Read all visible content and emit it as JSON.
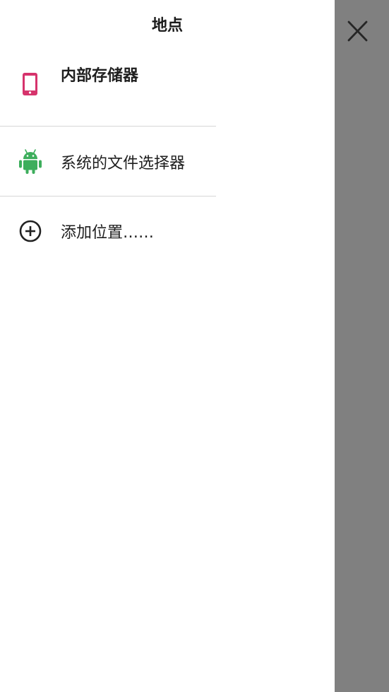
{
  "header": {
    "title": "地点"
  },
  "locations": [
    {
      "label": "内部存储器",
      "icon": "phone-icon",
      "color": "#d6336c"
    },
    {
      "label": "系统的文件选择器",
      "icon": "android-icon",
      "color": "#3dae5c"
    },
    {
      "label": "添加位置……",
      "icon": "add-circle-icon",
      "color": "#222222"
    }
  ],
  "close": {
    "icon": "close-icon"
  },
  "colors": {
    "scrim": "#808080",
    "drawer_background": "#ffffff"
  }
}
